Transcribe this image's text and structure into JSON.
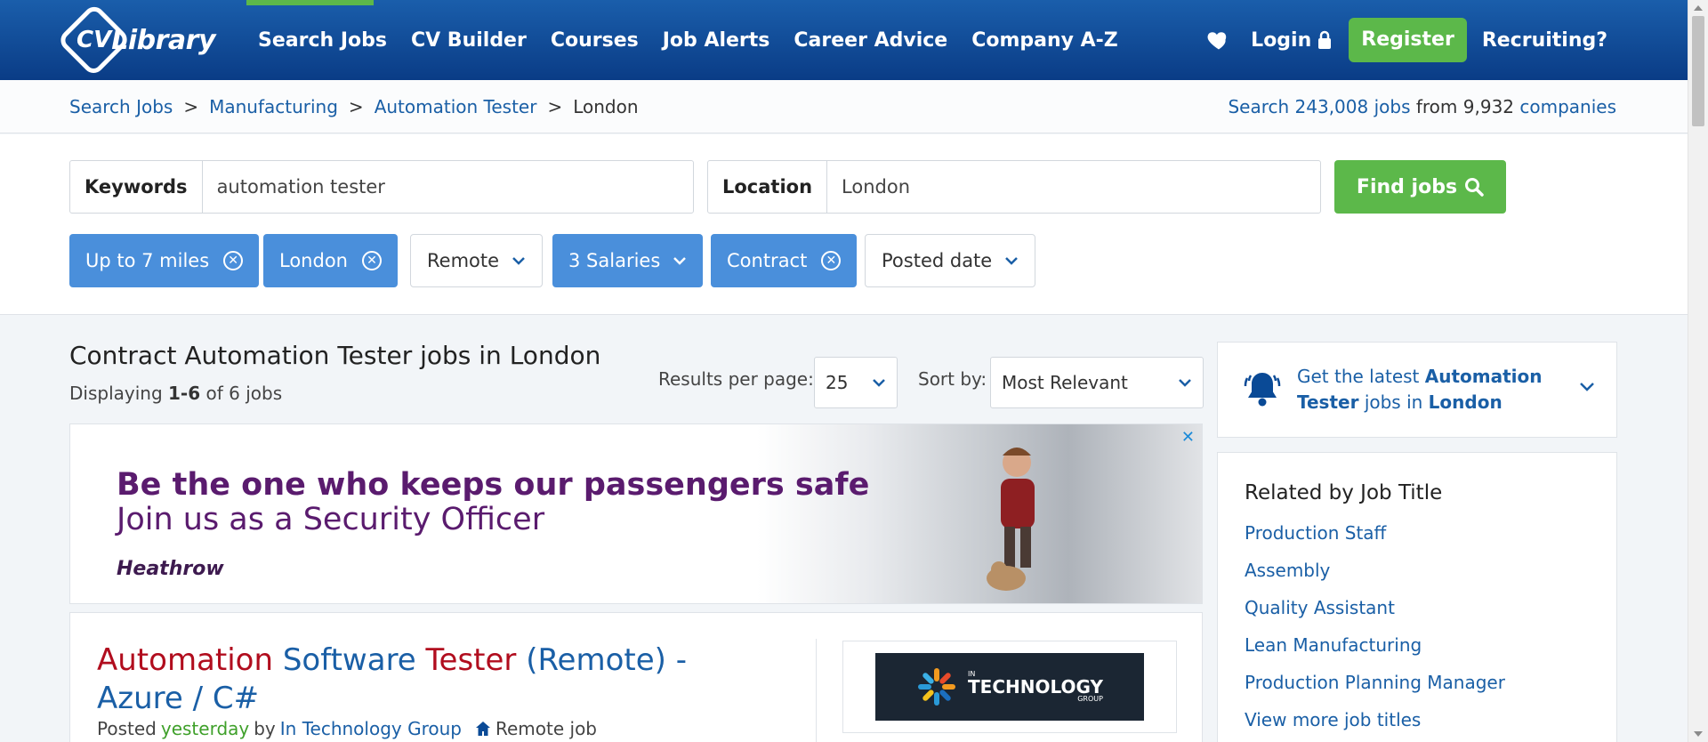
{
  "header": {
    "logo_text": "CV Library",
    "nav": [
      "Search Jobs",
      "CV Builder",
      "Courses",
      "Job Alerts",
      "Career Advice",
      "Company A-Z"
    ],
    "login": "Login",
    "register": "Register",
    "recruiting": "Recruiting?"
  },
  "breadcrumb": {
    "items": [
      "Search Jobs",
      "Manufacturing",
      "Automation Tester"
    ],
    "current": "London"
  },
  "stats": {
    "prefix": "Search",
    "jobs": "243,008 jobs",
    "middle": "from 9,932",
    "companies": "companies"
  },
  "search": {
    "keywords_label": "Keywords",
    "keywords_value": "automation tester",
    "location_label": "Location",
    "location_value": "London",
    "find_label": "Find jobs"
  },
  "filters": [
    {
      "label": "Up to 7 miles",
      "active": true
    },
    {
      "label": "London",
      "active": true
    },
    {
      "label": "Remote",
      "active": false
    },
    {
      "label": "3 Salaries",
      "active": true
    },
    {
      "label": "Contract",
      "active": true
    },
    {
      "label": "Posted date",
      "active": false
    }
  ],
  "results": {
    "title": "Contract Automation Tester jobs in London",
    "displaying_prefix": "Displaying",
    "range": "1-6",
    "of_text": "of 6 jobs",
    "per_page_label": "Results per page:",
    "per_page_value": "25",
    "sort_label": "Sort by:",
    "sort_value": "Most Relevant"
  },
  "ad": {
    "line1": "Be the one who keeps our passengers safe",
    "line2": "Join us as a Security Officer",
    "brand": "Heathrow"
  },
  "job": {
    "title_parts": [
      {
        "text": "Automation",
        "highlight": true
      },
      {
        "text": " Software ",
        "highlight": false
      },
      {
        "text": "Tester",
        "highlight": true
      },
      {
        "text": " (Remote) - Azure / C#",
        "highlight": false
      }
    ],
    "posted_prefix": "Posted",
    "posted_when": "yesterday",
    "by_text": "by",
    "company": "In Technology Group",
    "remote_label": "Remote job",
    "logo_line1": "IN",
    "logo_line2": "TECHNOLOGY",
    "logo_line3": "GROUP"
  },
  "alert": {
    "prefix": "Get the latest",
    "keyword": "Automation Tester",
    "middle": "jobs in",
    "location": "London"
  },
  "related": {
    "heading": "Related by Job Title",
    "items": [
      "Production Staff",
      "Assembly",
      "Quality Assistant",
      "Lean Manufacturing",
      "Production Planning Manager",
      "View more job titles"
    ]
  },
  "colors": {
    "header": "#0a4a96",
    "accent_green": "#5cb84a",
    "chip_blue": "#4a8fdb",
    "link": "#1a5fa6",
    "highlight_red": "#b10d1e"
  }
}
